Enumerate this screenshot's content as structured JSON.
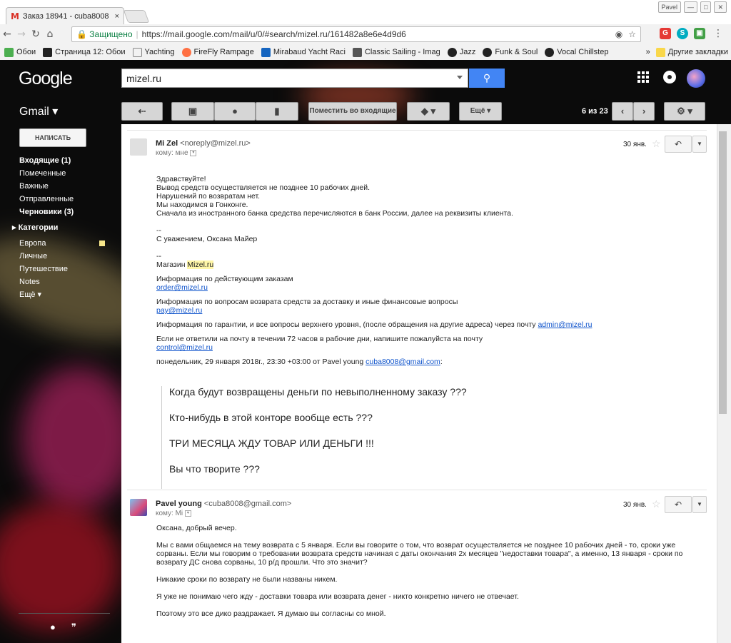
{
  "browser": {
    "tab_title": "Заказ 18941 - cuba8008",
    "tab_close": "×",
    "window_user": "Pavel",
    "security_label": "Защищено",
    "url": "https://mail.google.com/mail/u/0/#search/mizel.ru/161482a8e6e4d9d6",
    "bookmarks": [
      {
        "label": "Обои",
        "icon_color": "#4caf50"
      },
      {
        "label": "Страница 12: Обои",
        "icon_color": "#222222"
      },
      {
        "label": "Yachting",
        "icon_color": "#ffffff"
      },
      {
        "label": "FireFly Rampage",
        "icon_color": "#ff7043"
      },
      {
        "label": "Mirabaud Yacht Raci",
        "icon_color": "#1565c0"
      },
      {
        "label": "Classic Sailing - Imag",
        "icon_color": "#555555"
      },
      {
        "label": "Jazz",
        "icon_color": "#222222"
      },
      {
        "label": "Funk & Soul",
        "icon_color": "#222222"
      },
      {
        "label": "Vocal Chillstep",
        "icon_color": "#222222"
      }
    ],
    "bookmarks_more": "»",
    "other_bookmarks": "Другие закладки"
  },
  "gmail": {
    "logo": "Google",
    "search_value": "mizel.ru",
    "app_label": "Gmail ▾",
    "toolbar": {
      "move_inbox": "Поместить во входящие",
      "more": "Ещё ▾",
      "counter": "6 из 23"
    },
    "compose": "НАПИСАТЬ",
    "nav": [
      {
        "label": "Входящие (1)",
        "bold": true
      },
      {
        "label": "Помеченные",
        "bold": false
      },
      {
        "label": "Важные",
        "bold": false
      },
      {
        "label": "Отправленные",
        "bold": false
      },
      {
        "label": "Черновики (3)",
        "bold": true
      }
    ],
    "categories": "Категории",
    "labels": [
      "Европа",
      "Личные",
      "Путешествие",
      "Notes",
      "Ещё ▾"
    ]
  },
  "message1": {
    "sender_name": "Mi Zel",
    "sender_email": "<noreply@mizel.ru>",
    "to": "кому: мне",
    "date": "30 янв.",
    "lines": [
      "Здравствуйте!",
      "Вывод средств осуществляется не позднее 10 рабочих дней.",
      "Нарушений по возвратам нет.",
      "Мы находимся в Гонконге.",
      "Сначала из иностранного банка средства перечисляются в банк России, далее на реквизиты клиента."
    ],
    "dash1": "--",
    "regards": "С уважением, Оксана Майер",
    "dash2": "--",
    "shop_prefix": "Магазин ",
    "shop_name": "Mizel.ru",
    "info_orders": "Информация по действующим заказам",
    "email_order": "order@mizel.ru",
    "info_refunds": "Информация по вопросам возврата средств за доставку и иные финансовые вопросы",
    "email_pay": "pay@mizel.ru",
    "info_warranty": "Информация по гарантии, и все вопросы верхнего уровня, (после обращения на другие адреса) через почту ",
    "email_admin": "admin@mizel.ru",
    "info_noanswer": "Если не ответили на почту в течении 72 часов в рабочие дни, напишите пожалуйста на почту",
    "email_control": "control@mizel.ru",
    "quote_header_prefix": "понедельник, 29 января 2018г., 23:30 +03:00 от Pavel young ",
    "quote_header_email": "cuba8008@gmail.com",
    "quote_header_suffix": ":",
    "quote_lines": [
      "Когда будут возвращены деньги по невыполненному заказу ???",
      "Кто-нибудь в этой конторе вообще есть ???",
      "ТРИ МЕСЯЦА ЖДУ ТОВАР ИЛИ ДЕНЬГИ !!!",
      "Вы что творите ???"
    ]
  },
  "message2": {
    "sender_name": "Pavel young",
    "sender_email": "<cuba8008@gmail.com>",
    "to": "кому: Mi",
    "date": "30 янв.",
    "greeting": "Оксана, добрый вечер.",
    "para1": "Мы с вами общаемся на тему возврата с 5 января. Если вы говорите о том, что возврат осуществляется не позднее 10 рабочих дней - то, сроки уже сорваны. Если мы говорим о требовании возврата средств начиная с даты окончания 2х месяцев \"недоставки товара\", а именно, 13 января - сроки по возврату ДС снова сорваны, 10 р/д прошли. Что это значит?",
    "para2": "Никакие сроки по возврату не были названы никем.",
    "para3": "Я уже не понимаю чего жду - доставки товара или возврата денег - никто конкретно ничего не отвечает.",
    "para4": "Поэтому это все дико раздражает. Я думаю вы согласны со мной."
  }
}
